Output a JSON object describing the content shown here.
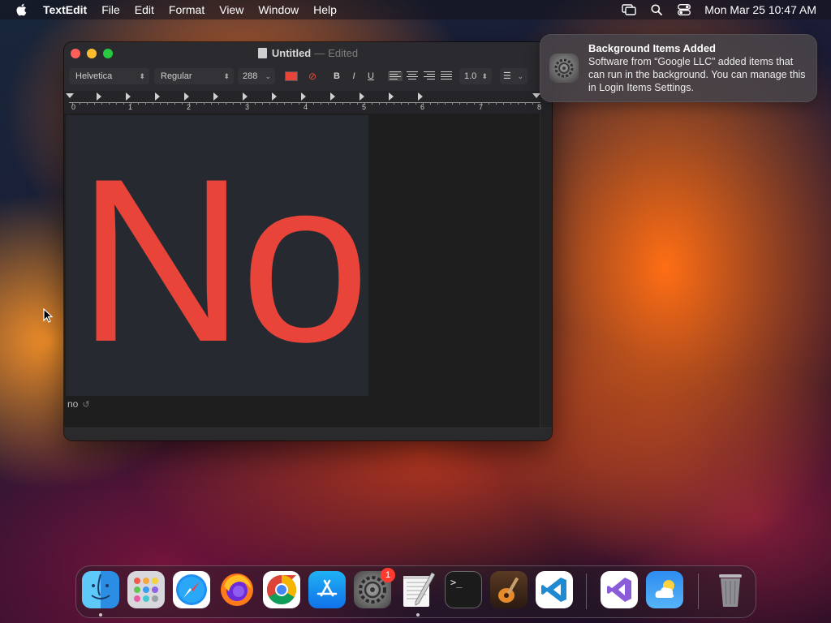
{
  "menubar": {
    "app_name": "TextEdit",
    "items": [
      "File",
      "Edit",
      "Format",
      "View",
      "Window",
      "Help"
    ],
    "clock": "Mon Mar 25  10:47 AM"
  },
  "window": {
    "title": "Untitled",
    "title_separator": "—",
    "title_state": "Edited",
    "toolbar": {
      "font_family": "Helvetica",
      "font_style": "Regular",
      "font_size": "288",
      "text_color": "#e8443a",
      "bold_label": "B",
      "italic_label": "I",
      "underline_label": "U",
      "line_spacing": "1.0",
      "selected_alignment": "left"
    },
    "ruler": {
      "numbers": [
        "0",
        "1",
        "2",
        "3",
        "4",
        "5",
        "6",
        "7",
        "8"
      ]
    },
    "document": {
      "text": "No",
      "text_color": "#e8443a",
      "background_color": "#262a30",
      "autocomplete_word": "no",
      "autocomplete_undo_glyph": "↺"
    }
  },
  "notification": {
    "title": "Background Items Added",
    "body": "Software from “Google LLC” added items that can run in the background. You can manage this in Login Items Settings.",
    "icon": "system-settings-icon"
  },
  "dock": {
    "apps": [
      {
        "name": "Finder",
        "icon": "finder-icon",
        "running": true
      },
      {
        "name": "Launchpad",
        "icon": "launchpad-icon",
        "running": false
      },
      {
        "name": "Safari",
        "icon": "safari-icon",
        "running": false
      },
      {
        "name": "Firefox",
        "icon": "firefox-icon",
        "running": false
      },
      {
        "name": "Google Chrome",
        "icon": "chrome-icon",
        "running": false
      },
      {
        "name": "App Store",
        "icon": "app-store-icon",
        "running": false
      },
      {
        "name": "System Settings",
        "icon": "system-settings-icon",
        "running": false,
        "badge": "1"
      },
      {
        "name": "TextEdit",
        "icon": "textedit-icon",
        "running": true
      },
      {
        "name": "Terminal",
        "icon": "terminal-icon",
        "running": false
      },
      {
        "name": "GarageBand",
        "icon": "garageband-icon",
        "running": false
      },
      {
        "name": "Visual Studio Code",
        "icon": "vscode-icon",
        "running": false
      },
      {
        "name": "Visual Studio",
        "icon": "visual-studio-icon",
        "running": false
      },
      {
        "name": "Weather",
        "icon": "weather-icon",
        "running": false
      },
      {
        "name": "Trash",
        "icon": "trash-icon",
        "running": false
      }
    ],
    "badge_text": "1",
    "terminal_prompt": ">_"
  }
}
